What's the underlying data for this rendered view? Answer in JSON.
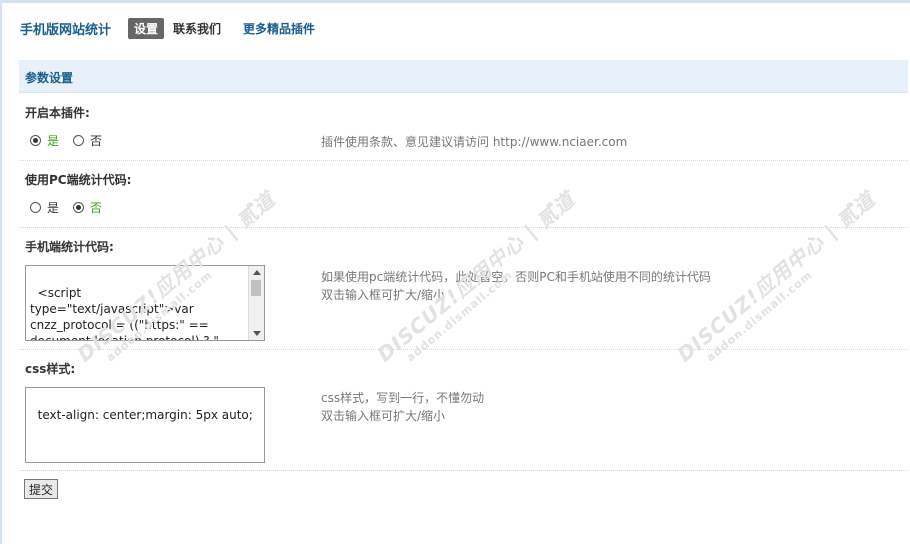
{
  "nav": {
    "brand": "手机版网站统计",
    "active_tab": "设置",
    "tab_contact": "联系我们",
    "more_link": "更多精品插件"
  },
  "section": {
    "title": "参数设置"
  },
  "enable_plugin": {
    "label": "开启本插件:",
    "options": [
      {
        "label": "是",
        "checked": true
      },
      {
        "label": "否",
        "checked": false
      }
    ],
    "comment": "插件使用条款、意见建议请访问 http://www.nciaer.com"
  },
  "use_pc_code": {
    "label": "使用PC端统计代码:",
    "options": [
      {
        "label": "是",
        "checked": false
      },
      {
        "label": "否",
        "checked": true
      }
    ]
  },
  "mobile_code": {
    "label": "手机端统计代码:",
    "value": "<script type=\"text/javascript\">var cnzz_protocol = ((\"https:\" == document.location.protocol) ? \" https://\" : \" http://\");document.write(unescape(\"",
    "comment_line1": "如果使用pc端统计代码，此处留空，否则PC和手机站使用不同的统计代码",
    "comment_line2": "双击输入框可扩大/缩小"
  },
  "css_style": {
    "label": "css样式:",
    "value": "text-align: center;margin: 5px auto;",
    "comment_line1": "css样式，写到一行，不懂勿动",
    "comment_line2": "双击输入框可扩大/缩小"
  },
  "submit_label": "提交",
  "watermark": {
    "brand": "DISCUZ!应用中心 | 贰道",
    "domain": "addon.dismall.com"
  }
}
